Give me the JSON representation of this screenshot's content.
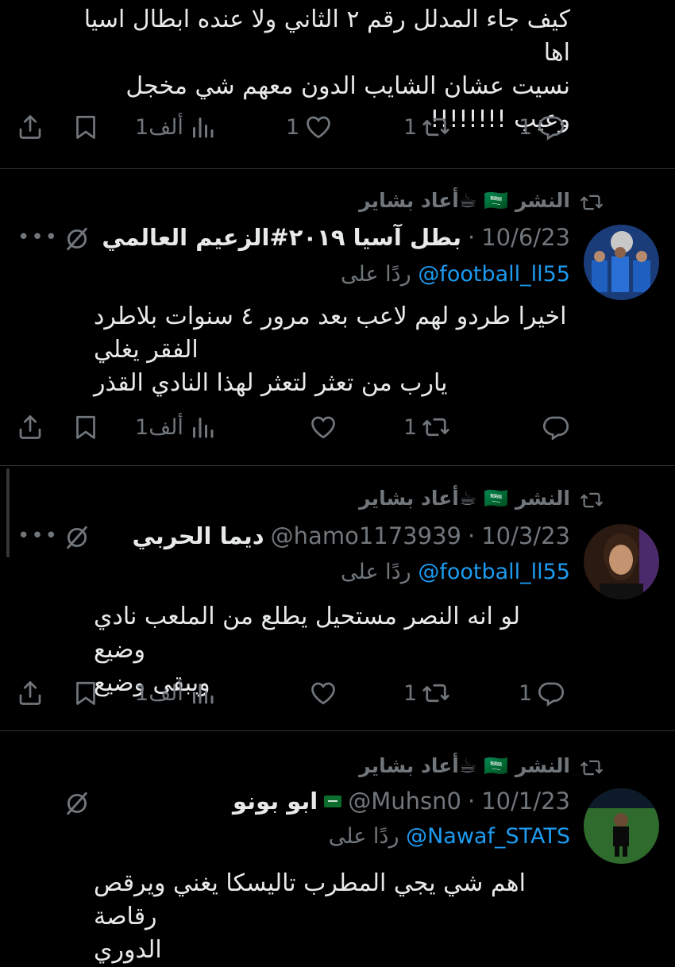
{
  "tweet0": {
    "text": "كيف جاء المدلل رقم ٢ الثاني ولا عنده ابطال اسيا اها\nنسيت عشان الشايب الدون معهم شي مخجل\nوعيب !!!!!!!!",
    "replies": "1",
    "reposts": "1",
    "likes": "1",
    "views": "1ألف"
  },
  "tweet1": {
    "retweeted_by": "أعاد بشاير☕ 🇸🇦 النشر",
    "name": "بطل آسيا ٢٠١٩#الزعيم العالمي",
    "handle": "",
    "date": "10/6/23",
    "reply_prefix": "ردًا على",
    "reply_to": "@football_ll55",
    "text": "اخيرا طردو لهم لاعب بعد مرور ٤ سنوات بلاطرد\nالفقر يغلي\nيارب من تعثر لتعثر لهذا النادي القذر",
    "replies": "",
    "reposts": "1",
    "likes": "",
    "views": "1ألف"
  },
  "tweet2": {
    "retweeted_by": "أعاد بشاير☕ 🇸🇦 النشر",
    "name": "ديما الحربي",
    "handle": "@hamo1173939",
    "date": "10/3/23",
    "reply_prefix": "ردًا على",
    "reply_to": "@football_ll55",
    "text": "لو انه النصر مستحيل يطلع من الملعب نادي وضيع\nويبقى وضيع",
    "replies": "1",
    "reposts": "1",
    "likes": "",
    "views": "1ألف"
  },
  "tweet3": {
    "retweeted_by": "أعاد بشاير☕ 🇸🇦 النشر",
    "name": "ابو بونو",
    "handle": "@Muhsn0",
    "date": "10/1/23",
    "reply_prefix": "ردًا على",
    "reply_to": "@Nawaf_STATS",
    "text": "اهم شي يجي المطرب تاليسكا يغني ويرقص رقاصة\nالدوري"
  },
  "colors": {
    "accent": "#1d9bf0",
    "muted": "#71767b",
    "text": "#e7e9ea",
    "background": "#000000"
  },
  "icons": [
    "reply-icon",
    "repost-icon",
    "like-icon",
    "views-icon",
    "bookmark-icon",
    "share-icon",
    "grok-icon",
    "more-icon"
  ]
}
